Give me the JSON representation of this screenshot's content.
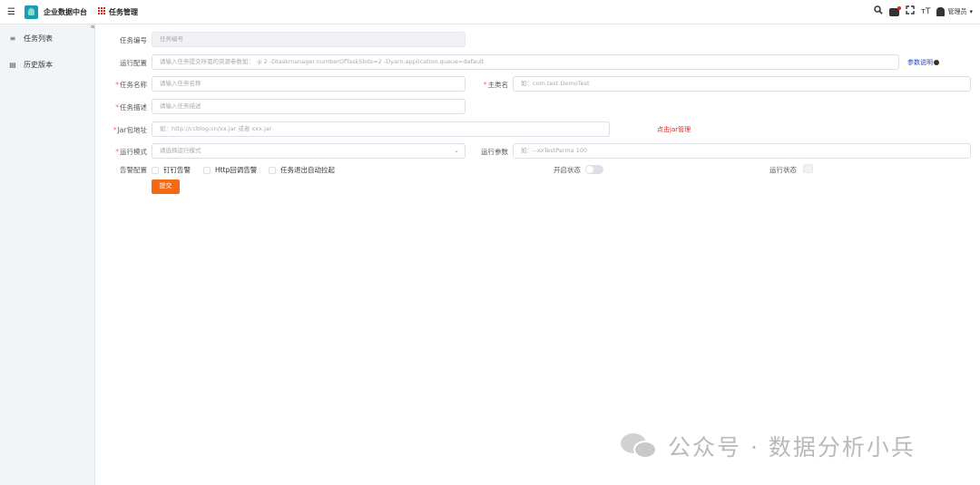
{
  "header": {
    "app_title": "企业数据中台",
    "module_title": "任务管理",
    "user_name": "管理员",
    "icons": [
      "menu-toggle-icon",
      "app-logo-icon",
      "grid-apps-icon",
      "search-icon",
      "message-icon",
      "fullscreen-icon",
      "font-size-icon",
      "user-avatar-icon",
      "caret-down-icon"
    ],
    "font_size_label": "тT"
  },
  "sidebar": {
    "items": [
      {
        "label": "任务列表",
        "icon": "list-icon"
      },
      {
        "label": "历史版本",
        "icon": "history-icon"
      }
    ],
    "collapse_icon": "«"
  },
  "form": {
    "task_no": {
      "label": "任务编号",
      "placeholder": "任务编号"
    },
    "run_config": {
      "label": "运行配置",
      "placeholder": "请输入任务提交所需的资源参数如：  -p 2  -Dtaskmanager.numberOfTaskSlots=2  -Dyarn.application.queue=default"
    },
    "param_doc_link": "参数说明",
    "task_name": {
      "label": "任务名称",
      "placeholder": "请输入任务名称"
    },
    "main_class": {
      "label": "主类名",
      "placeholder": "如：com.test.DemoTest"
    },
    "task_desc": {
      "label": "任务描述",
      "placeholder": "请输入任务描述"
    },
    "jar_url": {
      "label": "Jar包地址",
      "placeholder": "如：http://ccblog.cn/xx.jar 或者 xxx.jar"
    },
    "jar_manage_link": "点击jar管理",
    "run_mode": {
      "label": "运行模式",
      "placeholder": "请选择运行模式"
    },
    "run_args": {
      "label": "运行参数",
      "placeholder": "如：--xxTestParma 100"
    },
    "alarm_config": {
      "label": "告警配置",
      "options": [
        "钉钉告警",
        "Http回调告警",
        "任务退出自动拉起"
      ]
    },
    "enable_status": {
      "label": "开启状态",
      "value": false
    },
    "run_status": {
      "label": "运行状态"
    },
    "submit_label": "提交"
  },
  "watermark": {
    "text": "公众号 · 数据分析小兵"
  },
  "colors": {
    "accent": "#f36a12",
    "link": "#1e3fe0",
    "danger": "#e2231a",
    "sidebar_bg": "#f2f5f7"
  }
}
